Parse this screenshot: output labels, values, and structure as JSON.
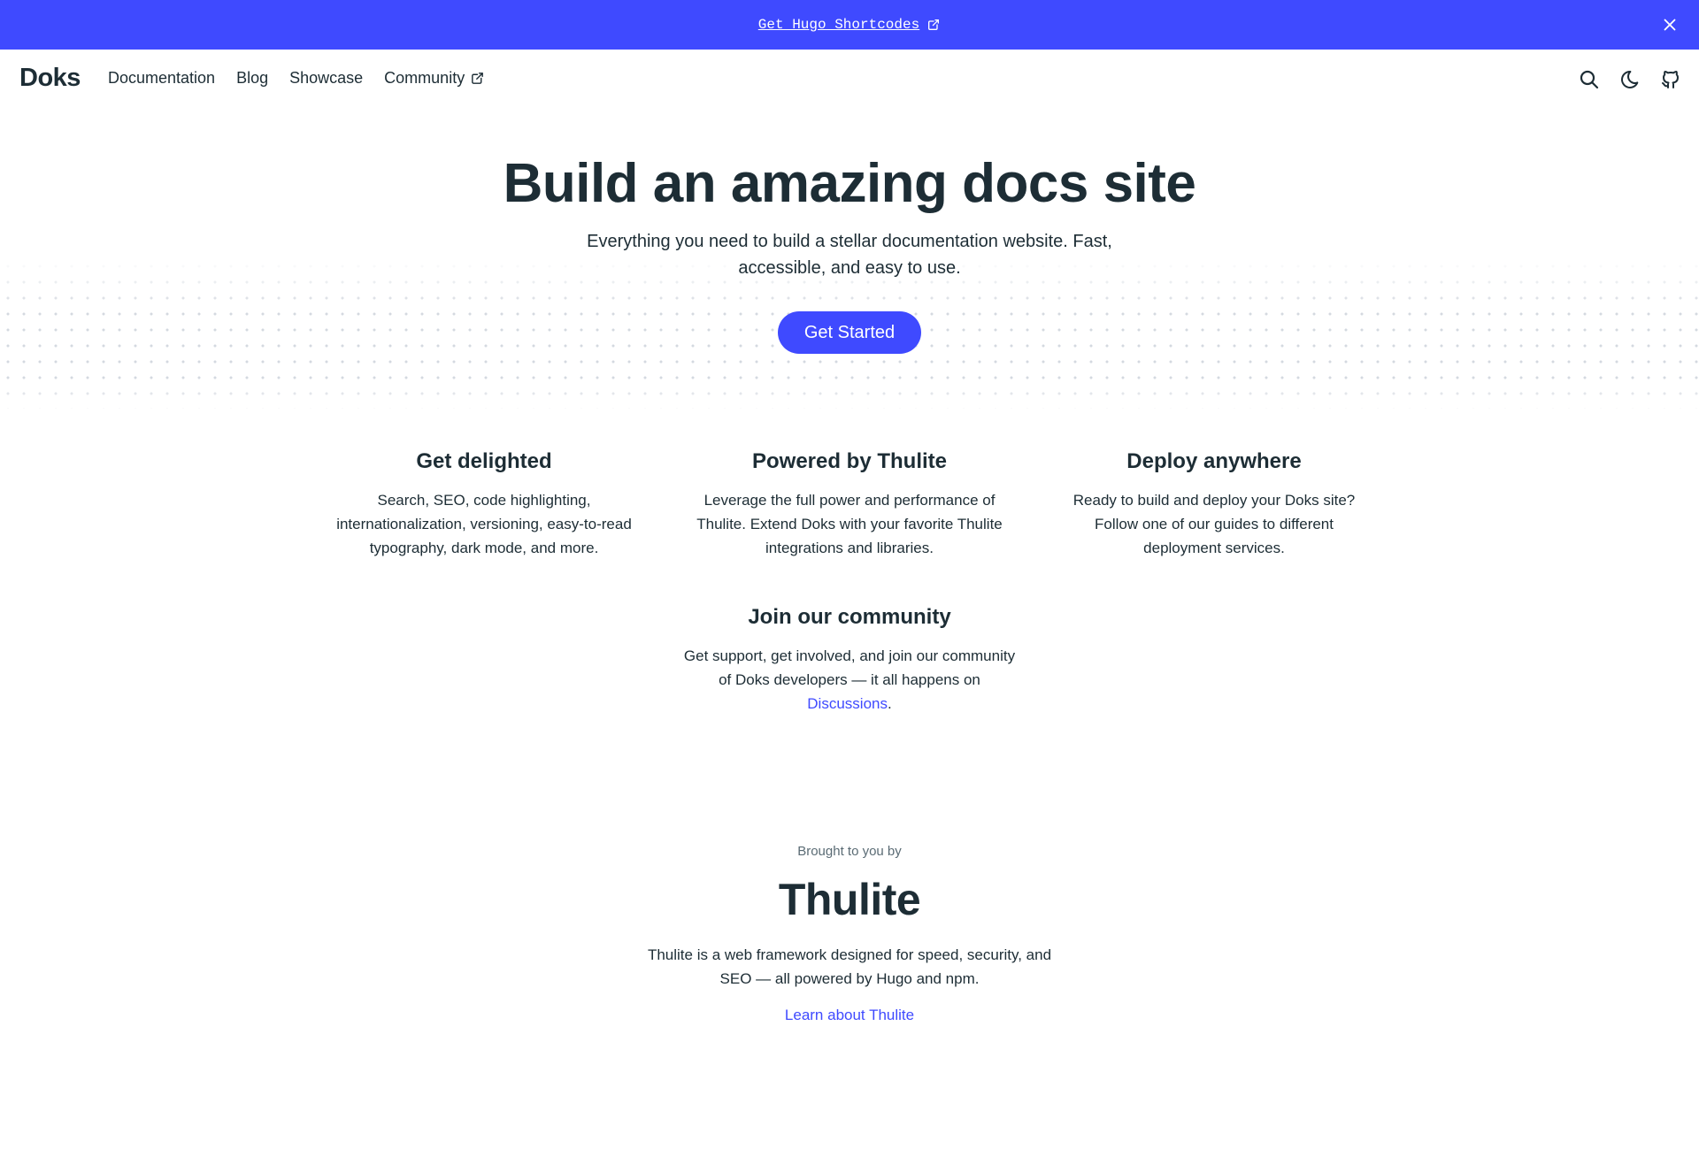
{
  "announcement": {
    "link_text": "Get Hugo Shortcodes"
  },
  "navbar": {
    "brand": "Doks",
    "links": [
      {
        "label": "Documentation"
      },
      {
        "label": "Blog"
      },
      {
        "label": "Showcase"
      },
      {
        "label": "Community"
      }
    ],
    "icons": [
      "search-icon",
      "moon-icon",
      "github-icon"
    ]
  },
  "hero": {
    "title": "Build an amazing docs site",
    "subtitle": "Everything you need to build a stellar documentation website. Fast, accessible, and easy to use.",
    "cta_label": "Get Started"
  },
  "features": [
    {
      "title": "Get delighted",
      "text": "Search, SEO, code highlighting, internationalization, versioning, easy-to-read typography, dark mode, and more."
    },
    {
      "title": "Powered by Thulite",
      "text": "Leverage the full power and performance of Thulite. Extend Doks with your favorite Thulite integrations and libraries."
    },
    {
      "title": "Deploy anywhere",
      "text": "Ready to build and deploy your Doks site? Follow one of our guides to different deployment services."
    },
    {
      "title": "Join our community",
      "text_before": "Get support, get involved, and join our community of Doks developers — it all happens on ",
      "link": "Discussions",
      "text_after": "."
    }
  ],
  "thulite": {
    "brought_by": "Brought to you by",
    "logo": "Thulite",
    "description": "Thulite is a web framework designed for speed, security, and SEO — all powered by Hugo and npm.",
    "learn_link": "Learn about Thulite"
  },
  "colors": {
    "accent": "#3f4aff",
    "text": "#1d2d35"
  }
}
